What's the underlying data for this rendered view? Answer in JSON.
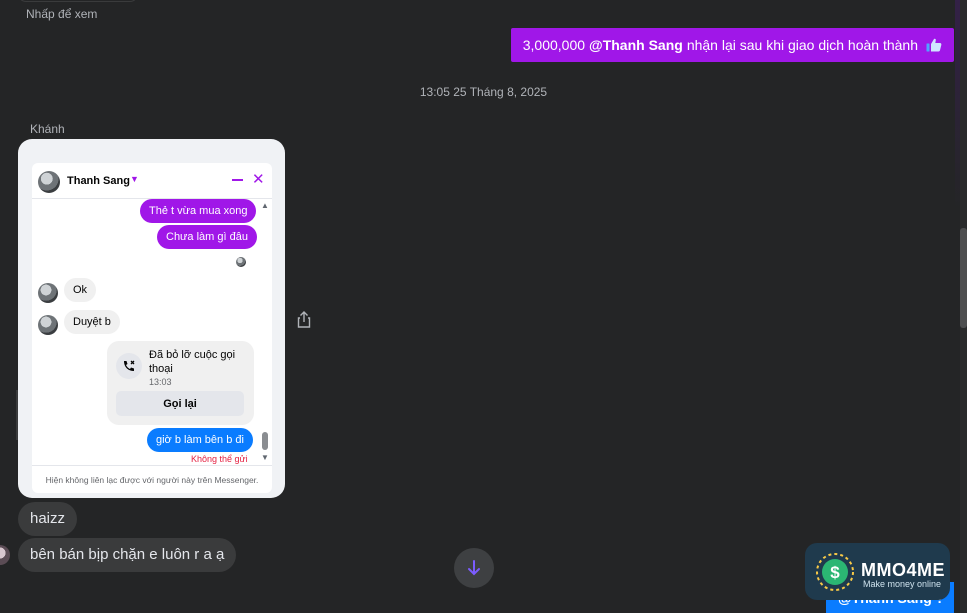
{
  "hint": {
    "tap_to_view": "Nhấp để xem"
  },
  "outgoing": {
    "amount": "3,000,000",
    "mention": "@Thanh Sang",
    "rest": "nhận lại sau khi giao dịch hoàn thành",
    "color": "#a017e8"
  },
  "timestamp": "13:05 25 Tháng 8, 2025",
  "sender_name": "Khánh",
  "embedded": {
    "contact_name": "Thanh Sang",
    "messages": {
      "m1": "Thẻ t vừa mua xong",
      "m2": "Chưa làm gì đâu",
      "m3": "Ok",
      "m4": "Duyệt b",
      "call_title": "Đã bỏ lỡ cuộc gọi thoại",
      "call_time": "13:03",
      "call_button": "Gọi lại",
      "m5": "giờ b làm bên b đi",
      "failed": "Không thể gửi"
    },
    "footer": "Hiện không liên lạc được với người này trên Messenger."
  },
  "incoming": {
    "m1": "haizz",
    "m2": "bên bán bịp chặn e luôn r a ạ"
  },
  "watermark": {
    "brand": "MMO4ME",
    "tagline": "Make money online",
    "under_text": "@Thanh Sang ?"
  },
  "icons": [
    "thumbs-up-icon",
    "chevron-down-icon",
    "minimize-icon",
    "close-icon",
    "missed-call-icon",
    "share-icon",
    "arrow-down-icon"
  ]
}
